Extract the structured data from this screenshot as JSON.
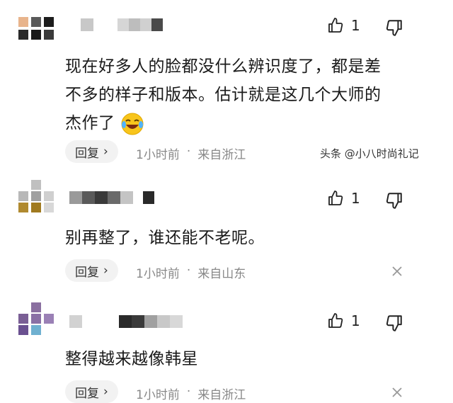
{
  "watermark": "头条 @小八时尚礼记",
  "comments": [
    {
      "likes": "1",
      "text_lines": [
        "现在好多人的脸都没什么辨识度了，都是差",
        "不多的样子和版本。估计就是这几个大师的",
        "杰作了"
      ],
      "reply_label": "回复",
      "time": "1小时前",
      "location": "来自浙江",
      "emoji": "laughing-crying-emoji"
    },
    {
      "likes": "1",
      "text_lines": [
        "别再整了，谁还能不老呢。"
      ],
      "reply_label": "回复",
      "time": "1小时前",
      "location": "来自山东"
    },
    {
      "likes": "1",
      "text_lines": [
        "整得越来越像韩星"
      ],
      "reply_label": "回复",
      "time": "1小时前",
      "location": "来自浙江"
    }
  ],
  "icons": {
    "like": "thumbs-up-icon",
    "dislike": "thumbs-down-icon",
    "reply_arrow": "chevron-right-icon",
    "dismiss": "close-icon"
  }
}
